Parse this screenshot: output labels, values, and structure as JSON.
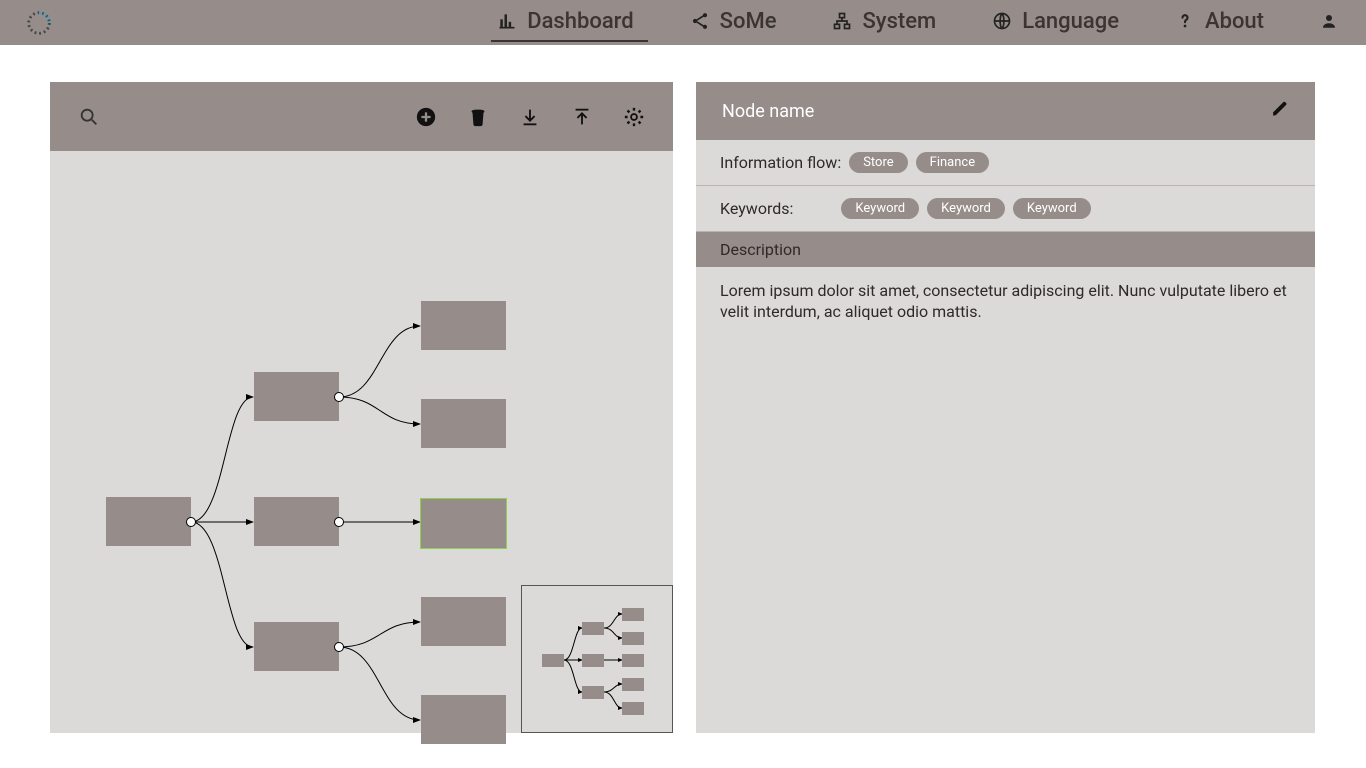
{
  "nav": {
    "items": [
      {
        "label": "Dashboard"
      },
      {
        "label": "SoMe"
      },
      {
        "label": "System"
      },
      {
        "label": "Language"
      },
      {
        "label": "About"
      }
    ]
  },
  "detail": {
    "title": "Node name",
    "info_flow_label": "Information flow:",
    "info_flow_tags": [
      "Store",
      "Finance"
    ],
    "keywords_label": "Keywords:",
    "keywords": [
      "Keyword",
      "Keyword",
      "Keyword"
    ],
    "description_label": "Description",
    "description_body": "Lorem ipsum dolor sit amet, consectetur adipiscing elit. Nunc vulputate libero et velit interdum, ac aliquet odio mattis."
  }
}
